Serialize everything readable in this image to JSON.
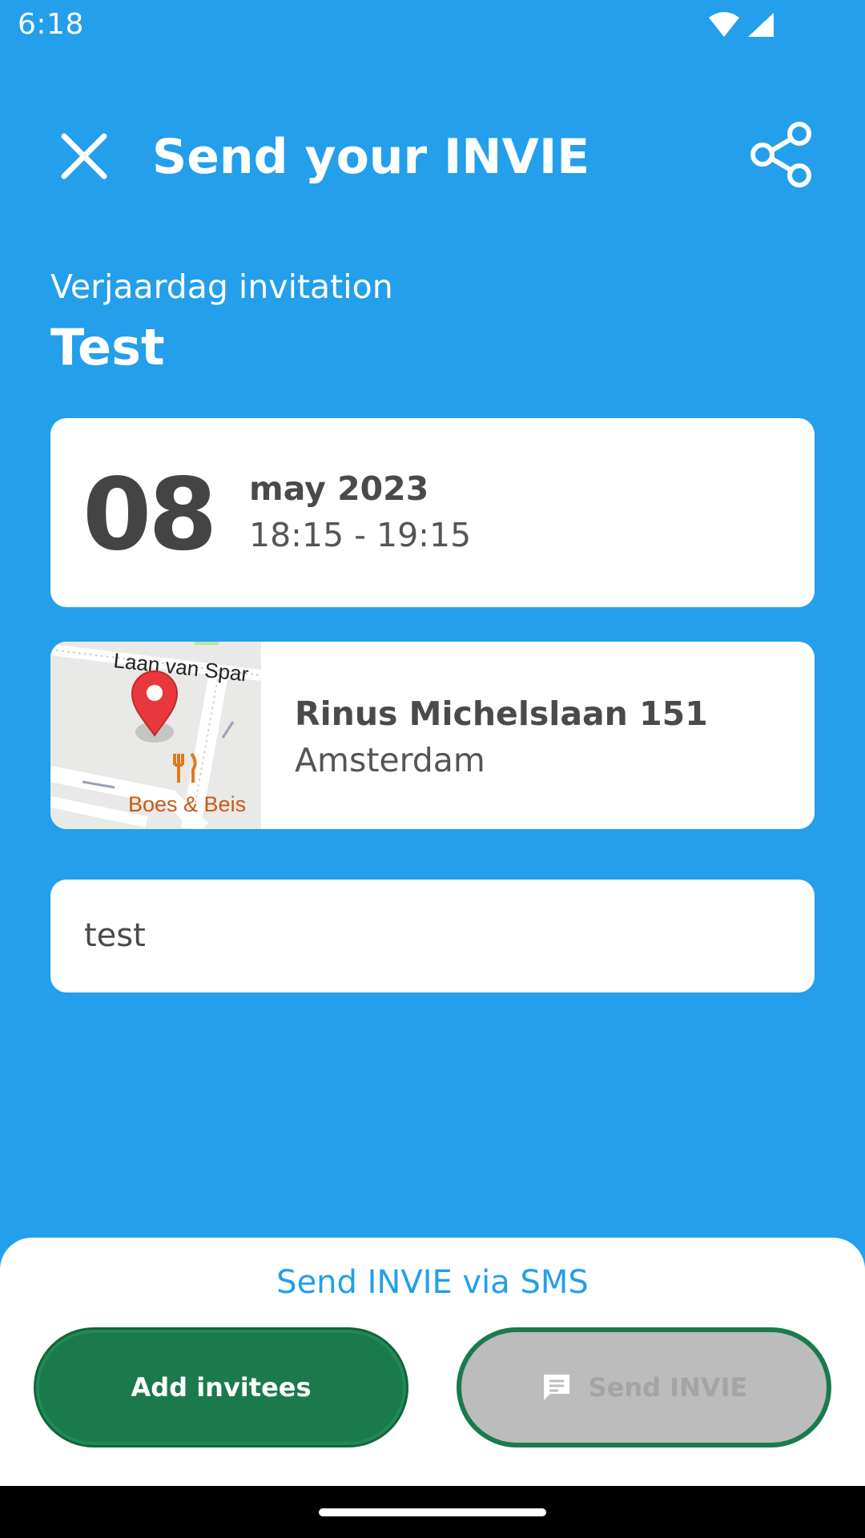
{
  "status_bar": {
    "time": "6:18"
  },
  "header": {
    "title": "Send your INVIE"
  },
  "invitation": {
    "type": "Verjaardag invitation",
    "name": "Test"
  },
  "date": {
    "day": "08",
    "month_year": "may 2023",
    "time_range": "18:15 - 19:15"
  },
  "location": {
    "street": "Rinus Michelslaan 151",
    "city": "Amsterdam",
    "map_labels": {
      "road": "Laan van Spar",
      "poi": "Boes & Beis"
    }
  },
  "message": {
    "text": "test"
  },
  "actions": {
    "sms_link": "Send INVIE via SMS",
    "add_invitees": "Add invitees",
    "send_invie": "Send INVIE"
  },
  "colors": {
    "background": "#239FEB",
    "primary_green": "#1A7A4C",
    "disabled_gray": "#bcbcbc",
    "card": "#ffffff"
  }
}
